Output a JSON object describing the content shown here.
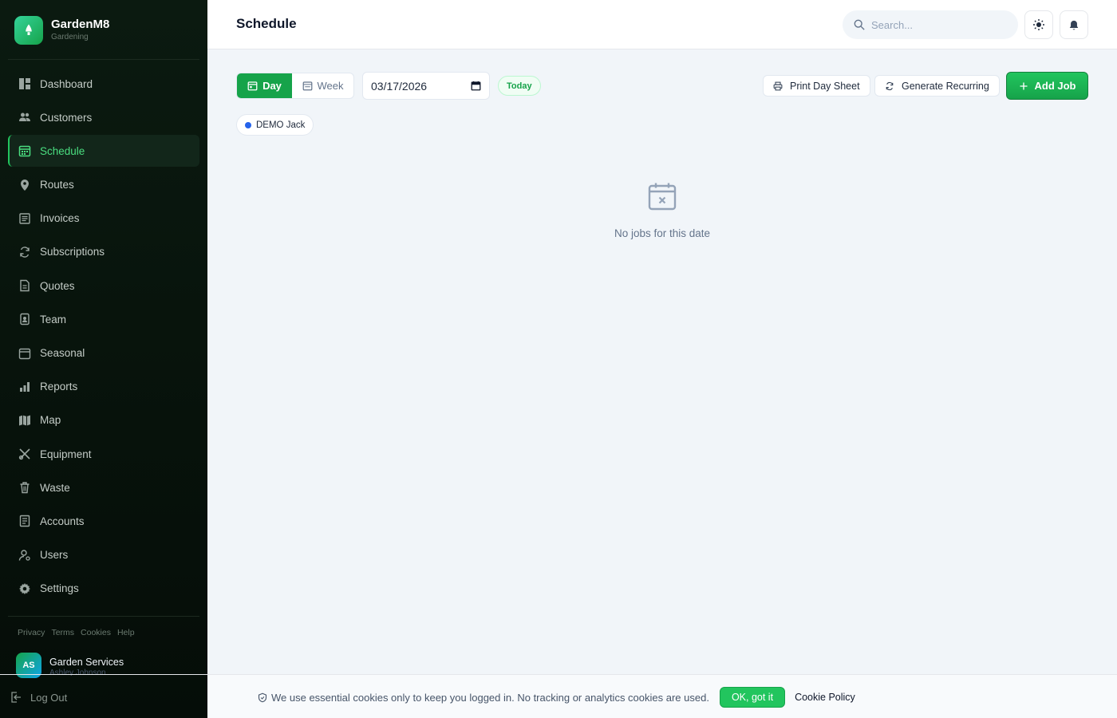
{
  "brand": {
    "name": "GardenM8",
    "subtitle": "Gardening"
  },
  "sidebar": {
    "items": [
      {
        "label": "Dashboard",
        "icon": "dashboard-icon"
      },
      {
        "label": "Customers",
        "icon": "users-icon"
      },
      {
        "label": "Schedule",
        "icon": "calendar-icon",
        "active": true
      },
      {
        "label": "Routes",
        "icon": "map-pin-icon"
      },
      {
        "label": "Invoices",
        "icon": "invoice-icon"
      },
      {
        "label": "Subscriptions",
        "icon": "refresh-icon"
      },
      {
        "label": "Quotes",
        "icon": "document-icon"
      },
      {
        "label": "Team",
        "icon": "badge-icon"
      },
      {
        "label": "Seasonal",
        "icon": "calendar-small-icon"
      },
      {
        "label": "Reports",
        "icon": "bar-chart-icon"
      },
      {
        "label": "Map",
        "icon": "map-icon"
      },
      {
        "label": "Equipment",
        "icon": "tools-icon"
      },
      {
        "label": "Waste",
        "icon": "trash-icon"
      },
      {
        "label": "Accounts",
        "icon": "ledger-icon"
      },
      {
        "label": "Users",
        "icon": "user-icon"
      },
      {
        "label": "Settings",
        "icon": "gear-icon"
      }
    ],
    "footer_links": [
      "Privacy",
      "Terms",
      "Cookies",
      "Help"
    ],
    "user": {
      "initials": "AS",
      "name": "Garden Services",
      "subtitle": "Ashley Johnson"
    },
    "logout_label": "Log Out"
  },
  "header": {
    "title": "Schedule",
    "search_placeholder": "Search..."
  },
  "toolbar": {
    "day_label": "Day",
    "week_label": "Week",
    "date_value": "03/17/2026",
    "today_label": "Today",
    "print_label": "Print Day Sheet",
    "generate_label": "Generate Recurring",
    "add_label": "Add Job"
  },
  "filter_chip": {
    "label": "DEMO Jack",
    "color": "#2563eb"
  },
  "empty_state": {
    "text": "No jobs for this date"
  },
  "cookie_bar": {
    "text": "We use essential cookies only to keep you logged in. No tracking or analytics cookies are used.",
    "ok_label": "OK, got it",
    "policy_label": "Cookie Policy"
  },
  "colors": {
    "accent": "#16a34a",
    "sidebar_bg": "#07120b",
    "chip_dot": "#2563eb"
  }
}
